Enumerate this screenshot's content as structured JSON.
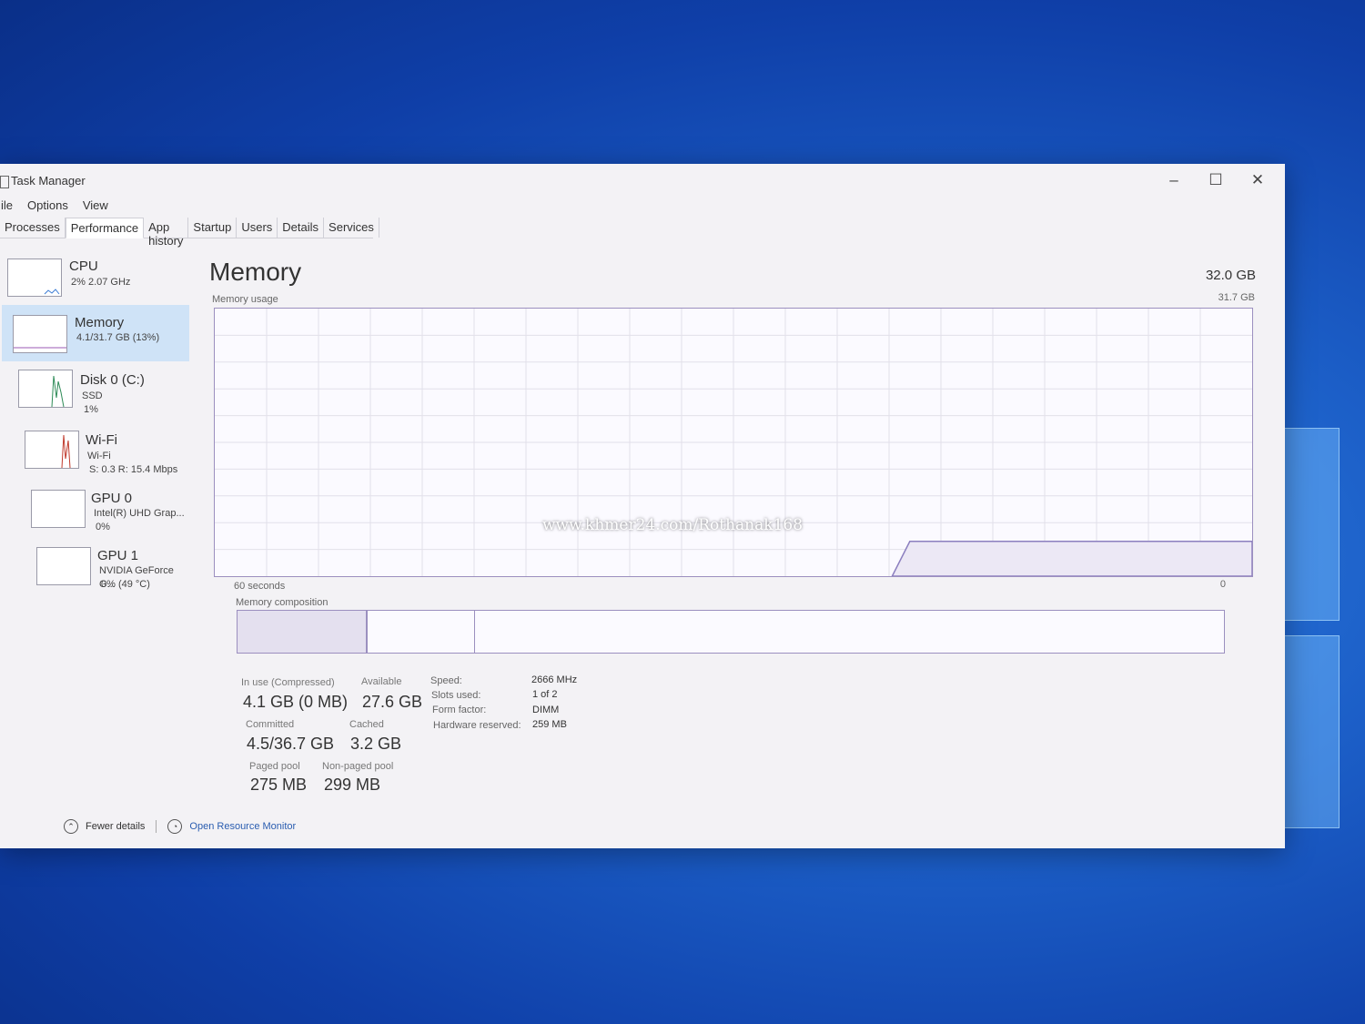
{
  "window": {
    "title": "Task Manager"
  },
  "menu": [
    "ile",
    "Options",
    "View"
  ],
  "tabs": [
    {
      "label": "Processes",
      "active": false
    },
    {
      "label": "Performance",
      "active": true
    },
    {
      "label": "App history",
      "active": false
    },
    {
      "label": "Startup",
      "active": false
    },
    {
      "label": "Users",
      "active": false
    },
    {
      "label": "Details",
      "active": false
    },
    {
      "label": "Services",
      "active": false
    }
  ],
  "sidebar": [
    {
      "name": "CPU",
      "sub": [
        "2% 2.07 GHz"
      ],
      "color": "#3a7bd5"
    },
    {
      "name": "Memory",
      "sub": [
        "4.1/31.7 GB (13%)"
      ],
      "color": "#9b59b6"
    },
    {
      "name": "Disk 0 (C:)",
      "sub": [
        "SSD",
        "1%"
      ],
      "color": "#2e8b57"
    },
    {
      "name": "Wi-Fi",
      "sub": [
        "Wi-Fi",
        "S: 0.3 R: 15.4 Mbps"
      ],
      "color": "#c0392b"
    },
    {
      "name": "GPU 0",
      "sub": [
        "Intel(R) UHD Grap...",
        "0%"
      ],
      "color": "#3a7bd5"
    },
    {
      "name": "GPU 1",
      "sub": [
        "NVIDIA GeForce G...",
        "0% (49 °C)"
      ],
      "color": "#3a7bd5"
    }
  ],
  "main": {
    "title": "Memory",
    "total": "32.0 GB",
    "usage_label": "Memory usage",
    "usage_max": "31.7 GB",
    "time_left": "60 seconds",
    "time_right": "0",
    "composition_label": "Memory composition",
    "composition": {
      "in_use_fraction": 0.13,
      "modified_fraction": 0.01,
      "standby_fraction": 0.1
    }
  },
  "stats": {
    "in_use_label": "In use (Compressed)",
    "in_use_value": "4.1 GB (0 MB)",
    "available_label": "Available",
    "available_value": "27.6 GB",
    "committed_label": "Committed",
    "committed_value": "4.5/36.7 GB",
    "cached_label": "Cached",
    "cached_value": "3.2 GB",
    "paged_label": "Paged pool",
    "paged_value": "275 MB",
    "nonpaged_label": "Non-paged pool",
    "nonpaged_value": "299 MB"
  },
  "specs": [
    {
      "label": "Speed:",
      "value": "2666 MHz"
    },
    {
      "label": "Slots used:",
      "value": "1 of 2"
    },
    {
      "label": "Form factor:",
      "value": "DIMM"
    },
    {
      "label": "Hardware reserved:",
      "value": "259 MB"
    }
  ],
  "footer": {
    "fewer_details": "Fewer details",
    "resource_monitor": "Open Resource Monitor"
  },
  "watermark": "www.khmer24.com/Rothanak168",
  "colors": {
    "memory_line": "#8c7fbf",
    "selection": "#cfe3f7"
  }
}
